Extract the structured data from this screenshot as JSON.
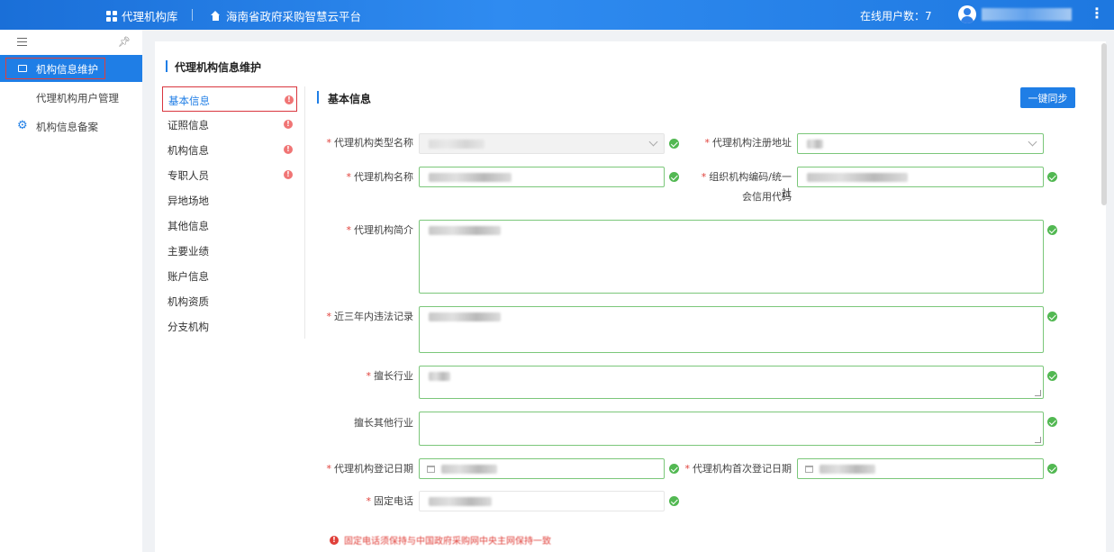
{
  "header": {
    "brand": "代理机构库",
    "platform": "海南省政府采购智慧云平台",
    "online_label": "在线用户数：7",
    "more_icon": "more-vertical-icon"
  },
  "sidebar": {
    "items": [
      {
        "label": "机构信息维护",
        "active": true
      },
      {
        "label": "代理机构用户管理"
      },
      {
        "label": "机构信息备案"
      }
    ]
  },
  "card": {
    "title": "代理机构信息维护"
  },
  "tabs": [
    {
      "label": "基本信息",
      "error": true,
      "active": true
    },
    {
      "label": "证照信息",
      "error": true
    },
    {
      "label": "机构信息",
      "error": true
    },
    {
      "label": "专职人员",
      "error": true
    },
    {
      "label": "异地场地",
      "error": false
    },
    {
      "label": "其他信息",
      "error": false
    },
    {
      "label": "主要业绩",
      "error": false
    },
    {
      "label": "账户信息",
      "error": false
    },
    {
      "label": "机构资质",
      "error": false
    },
    {
      "label": "分支机构",
      "error": false
    }
  ],
  "section": {
    "title": "基本信息",
    "sync_button": "一键同步"
  },
  "form": {
    "type_name": "代理机构类型名称",
    "reg_address": "代理机构注册地址",
    "agency_name": "代理机构名称",
    "org_code_line1": "组织机构编码/统一社",
    "org_code_line2": "会信用代码",
    "intro": "代理机构简介",
    "violations": "近三年内违法记录",
    "industry": "擅长行业",
    "other_industry": "擅长其他行业",
    "reg_date": "代理机构登记日期",
    "first_reg_date": "代理机构首次登记日期",
    "phone": "固定电话"
  },
  "notice": "固定电话须保持与中国政府采购网中央主网保持一致",
  "colors": {
    "primary": "#1f7ee6",
    "error": "#e0403a",
    "success": "#52b852"
  }
}
